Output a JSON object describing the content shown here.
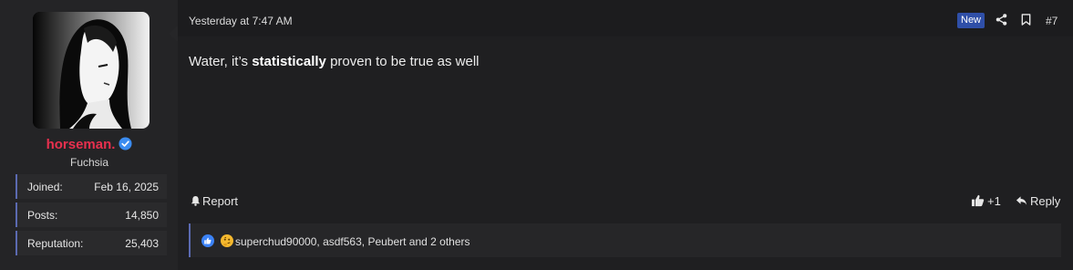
{
  "user": {
    "username": "horseman.",
    "user_title": "Fuchsia",
    "stats": [
      {
        "label": "Joined:",
        "value": "Feb 16, 2025"
      },
      {
        "label": "Posts:",
        "value": "14,850"
      },
      {
        "label": "Reputation:",
        "value": "25,403"
      }
    ],
    "username_color": "#e8304e",
    "verified_icon": "verified-check-icon"
  },
  "post": {
    "timestamp": "Yesterday at 7:47 AM",
    "new_badge": "New",
    "post_number": "#7",
    "body_prefix": "Water, it’s ",
    "body_bold": "statistically",
    "body_suffix": " proven to be true as well",
    "actions": {
      "report_label": "Report",
      "like_count": "+1",
      "reply_label": "Reply"
    },
    "reactions": {
      "icons": [
        "like-reaction-icon",
        "thinking-reaction-icon"
      ],
      "summary": "superchud90000, asdf563, Peubert and 2 others"
    }
  },
  "colors": {
    "accent": "#5b6ab1",
    "new_badge": "#2f4fa8",
    "like_blue": "#3b82f6"
  }
}
